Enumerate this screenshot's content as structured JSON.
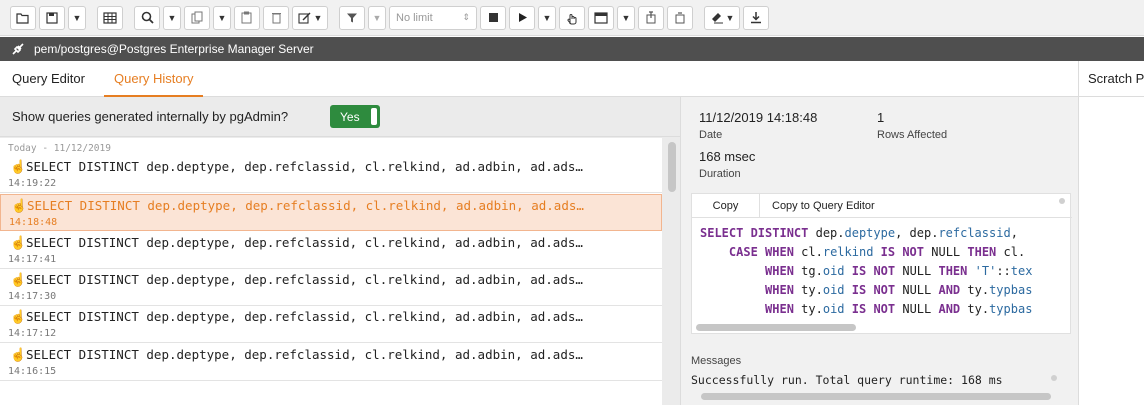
{
  "toolbar": {
    "limit_select": "No limit"
  },
  "connection": {
    "label": "pem/postgres@Postgres Enterprise Manager Server"
  },
  "tabs": {
    "query_editor": "Query Editor",
    "query_history": "Query History",
    "scratch_pad": "Scratch Pad"
  },
  "history": {
    "toggle_label": "Show queries generated internally by pgAdmin?",
    "toggle_value": "Yes",
    "group_label": "Today - 11/12/2019",
    "entries": [
      {
        "query": "SELECT DISTINCT dep.deptype, dep.refclassid, cl.relkind, ad.adbin, ad.ads…",
        "time": "14:19:22",
        "selected": false
      },
      {
        "query": "SELECT DISTINCT dep.deptype, dep.refclassid, cl.relkind, ad.adbin, ad.ads…",
        "time": "14:18:48",
        "selected": true
      },
      {
        "query": "SELECT DISTINCT dep.deptype, dep.refclassid, cl.relkind, ad.adbin, ad.ads…",
        "time": "14:17:41",
        "selected": false
      },
      {
        "query": "SELECT DISTINCT dep.deptype, dep.refclassid, cl.relkind, ad.adbin, ad.ads…",
        "time": "14:17:30",
        "selected": false
      },
      {
        "query": "SELECT DISTINCT dep.deptype, dep.refclassid, cl.relkind, ad.adbin, ad.ads…",
        "time": "14:17:12",
        "selected": false
      },
      {
        "query": "SELECT DISTINCT dep.deptype, dep.refclassid, cl.relkind, ad.adbin, ad.ads…",
        "time": "14:16:15",
        "selected": false
      }
    ]
  },
  "detail": {
    "date_value": "11/12/2019 14:18:48",
    "date_label": "Date",
    "rows_value": "1",
    "rows_label": "Rows Affected",
    "duration_value": "168 msec",
    "duration_label": "Duration",
    "copy_label": "Copy",
    "copy_to_editor_label": "Copy to Query Editor",
    "messages_label": "Messages",
    "messages_text": "Successfully run. Total query runtime: 168 ms"
  },
  "icon_names": [
    "open-folder-icon",
    "save-icon",
    "chevron-down-icon",
    "table-icon",
    "search-icon",
    "copy-icon",
    "paste-icon",
    "delete-icon",
    "edit-icon",
    "filter-icon",
    "stop-icon",
    "play-icon",
    "hand-icon",
    "grid-icon",
    "commit-icon",
    "rollback-icon",
    "eraser-icon",
    "download-icon",
    "connection-icon"
  ],
  "colors": {
    "accent": "#e67e22",
    "toggle_on": "#2e8b3e",
    "connbar": "#4f4f4f",
    "keyword": "#7a2f8f",
    "identifier": "#2c6aa0"
  }
}
